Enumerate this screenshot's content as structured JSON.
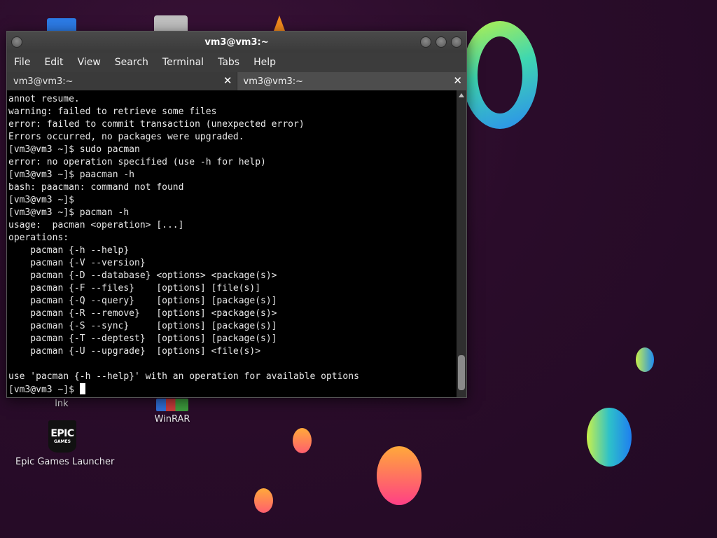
{
  "desktop": {
    "icons": [
      {
        "label": "lnk"
      },
      {
        "label": "WinRAR"
      },
      {
        "label": "Epic Games Launcher",
        "logo_text": "EPIC",
        "logo_sub": "GAMES"
      }
    ]
  },
  "window": {
    "title": "vm3@vm3:~",
    "menu": [
      "File",
      "Edit",
      "View",
      "Search",
      "Terminal",
      "Tabs",
      "Help"
    ],
    "tabs": [
      {
        "label": "vm3@vm3:~",
        "active": false
      },
      {
        "label": "vm3@vm3:~",
        "active": true
      }
    ],
    "close_glyph": "✕"
  },
  "terminal": {
    "lines": [
      "annot resume.",
      "warning: failed to retrieve some files",
      "error: failed to commit transaction (unexpected error)",
      "Errors occurred, no packages were upgraded.",
      "[vm3@vm3 ~]$ sudo pacman",
      "error: no operation specified (use -h for help)",
      "[vm3@vm3 ~]$ paacman -h",
      "bash: paacman: command not found",
      "[vm3@vm3 ~]$",
      "[vm3@vm3 ~]$ pacman -h",
      "usage:  pacman <operation> [...]",
      "operations:",
      "    pacman {-h --help}",
      "    pacman {-V --version}",
      "    pacman {-D --database} <options> <package(s)>",
      "    pacman {-F --files}    [options] [file(s)]",
      "    pacman {-Q --query}    [options] [package(s)]",
      "    pacman {-R --remove}   [options] <package(s)>",
      "    pacman {-S --sync}     [options] [package(s)]",
      "    pacman {-T --deptest}  [options] [package(s)]",
      "    pacman {-U --upgrade}  [options] <file(s)>",
      "",
      "use 'pacman {-h --help}' with an operation for available options"
    ],
    "prompt": "[vm3@vm3 ~]$ "
  }
}
